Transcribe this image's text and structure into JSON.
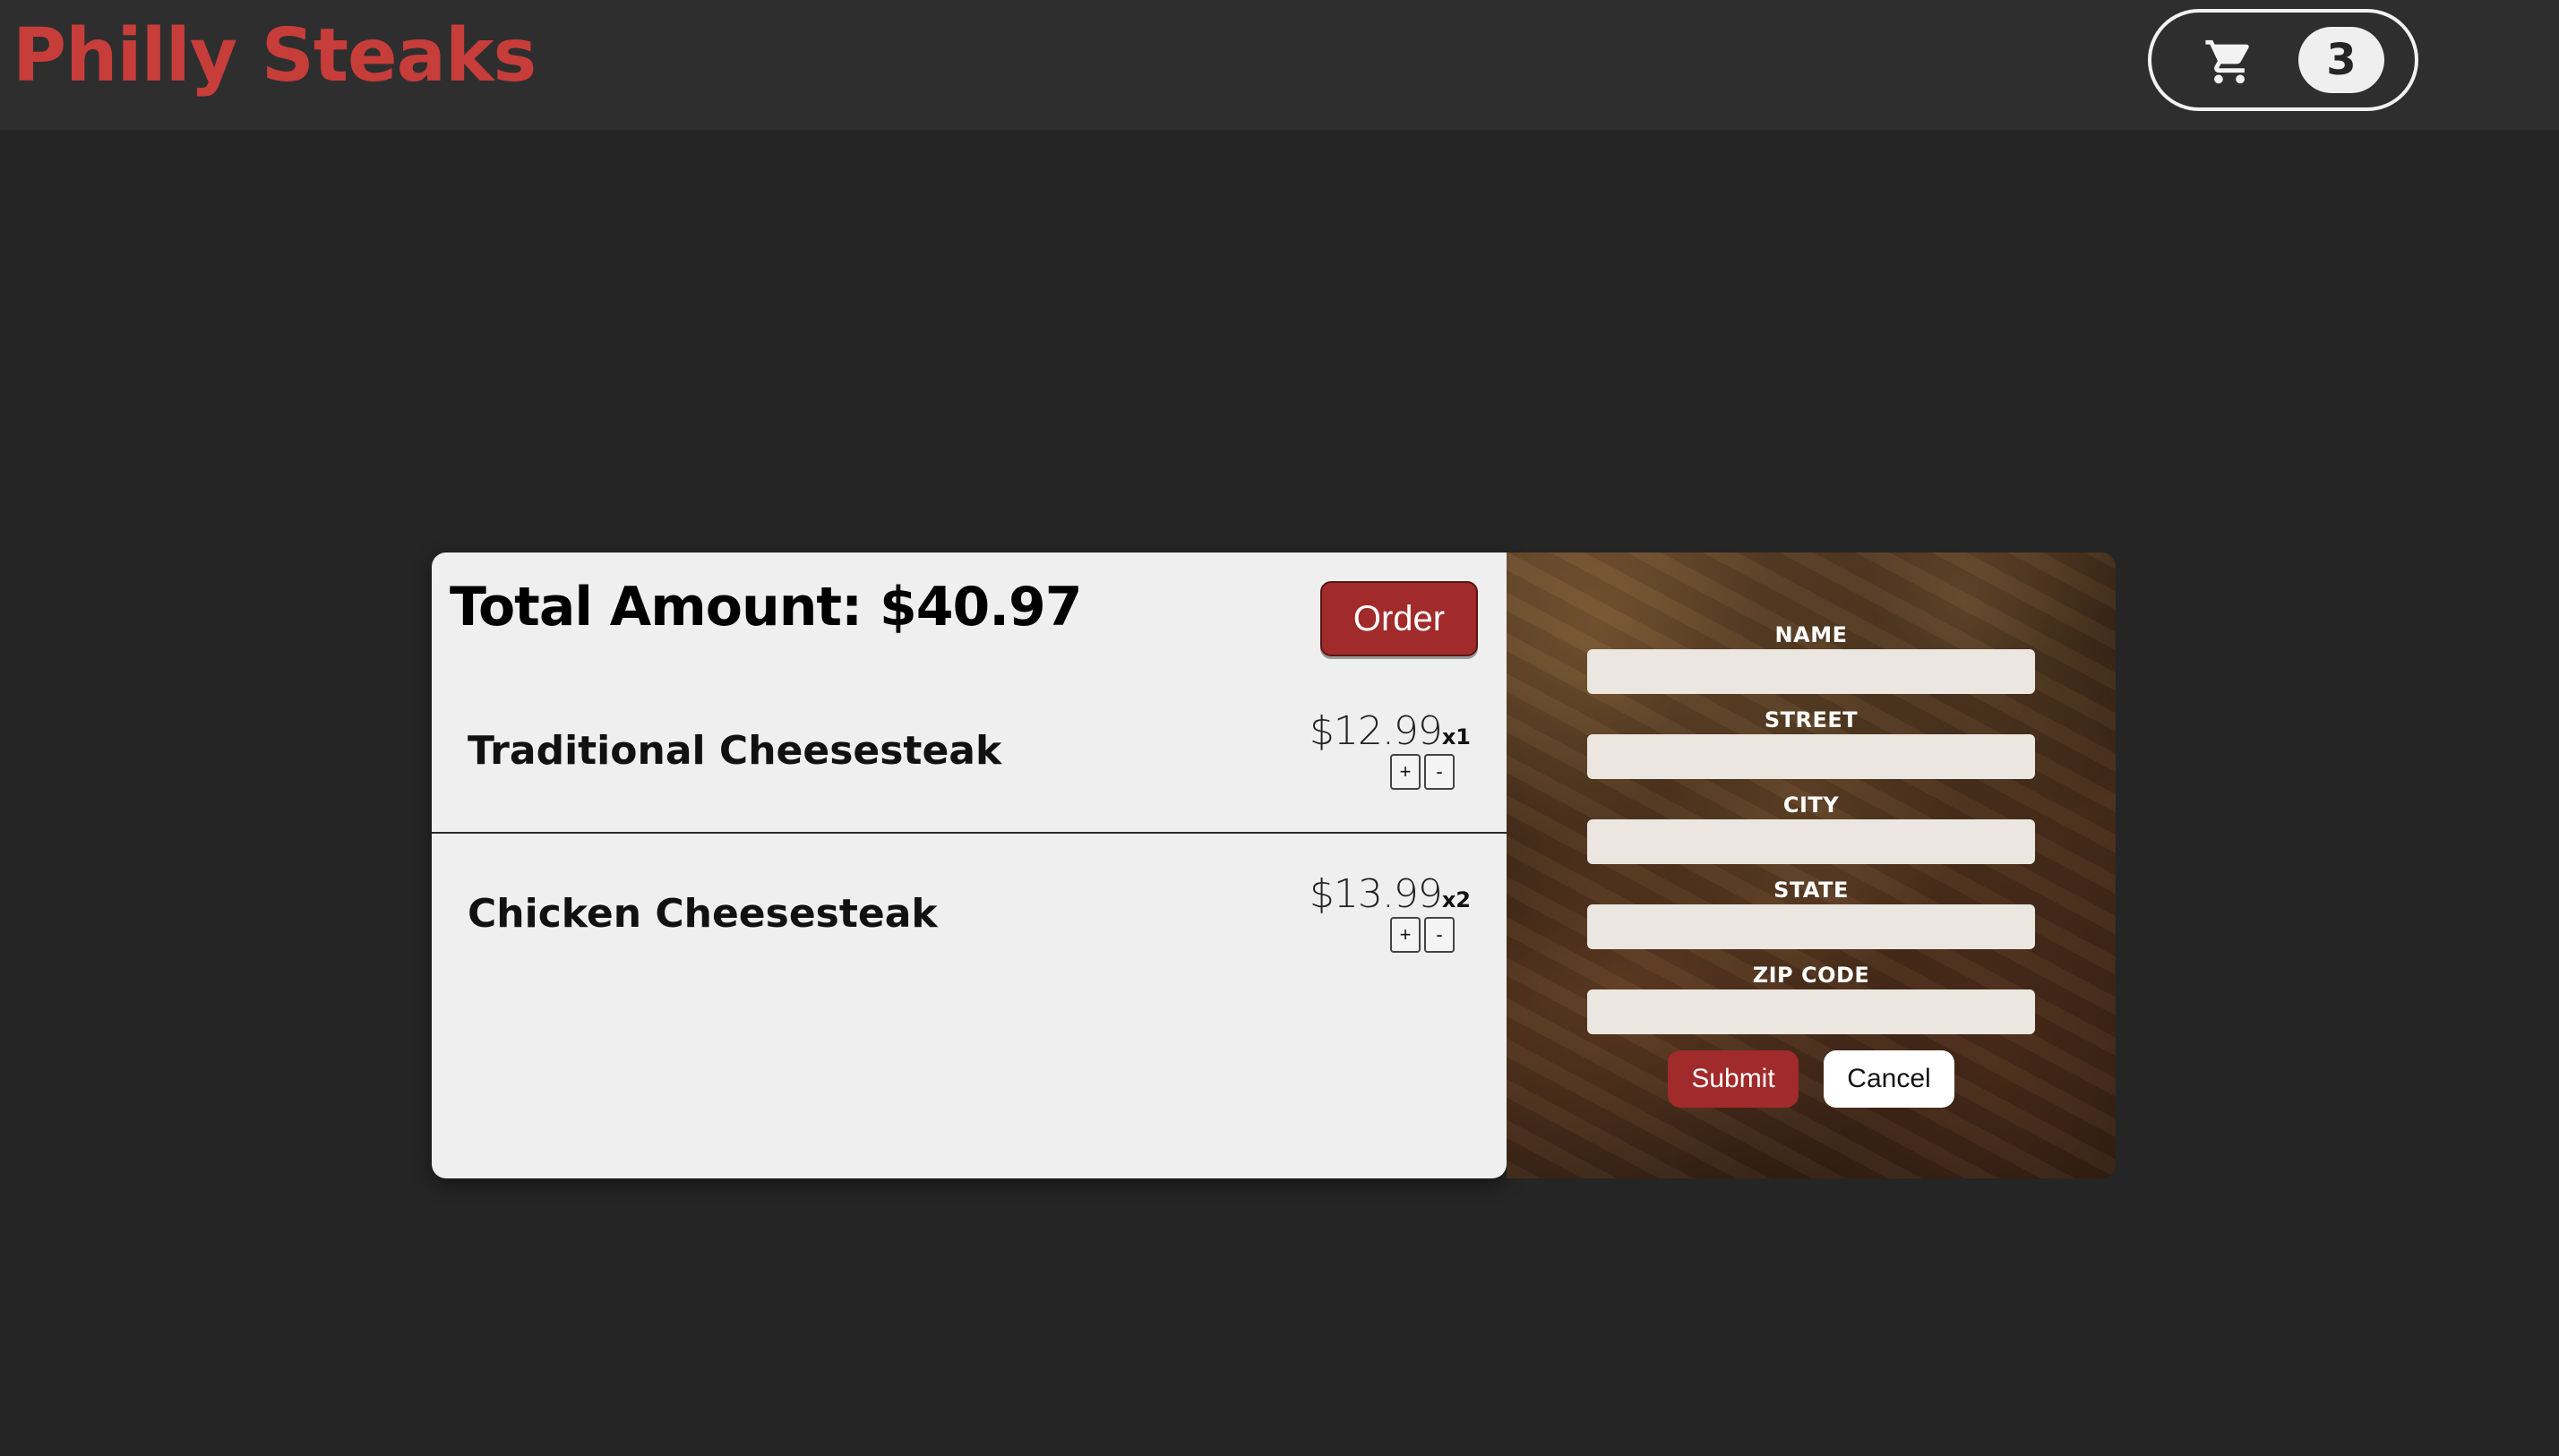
{
  "header": {
    "brand": "Philly Steaks",
    "cart": {
      "icon": "shopping-cart-icon",
      "count": "3"
    }
  },
  "cart": {
    "total_label": "Total Amount: $40.97",
    "order_label": "Order",
    "items": [
      {
        "name": "Traditional Cheesesteak",
        "price": "$12.99",
        "quantity": "x1",
        "increment_label": "+",
        "decrement_label": "-"
      },
      {
        "name": "Chicken Cheesesteak",
        "price": "$13.99",
        "quantity": "x2",
        "increment_label": "+",
        "decrement_label": "-"
      }
    ]
  },
  "checkout_form": {
    "fields": [
      {
        "label": "NAME",
        "value": ""
      },
      {
        "label": "STREET",
        "value": ""
      },
      {
        "label": "CITY",
        "value": ""
      },
      {
        "label": "STATE",
        "value": ""
      },
      {
        "label": "ZIP CODE",
        "value": ""
      }
    ],
    "submit_label": "Submit",
    "cancel_label": "Cancel"
  },
  "colors": {
    "page_background": "#252525",
    "header_background": "#2f2e2f",
    "brand": "#c73d39",
    "accent_button": "#a12a2a",
    "panel": "#efefef"
  }
}
